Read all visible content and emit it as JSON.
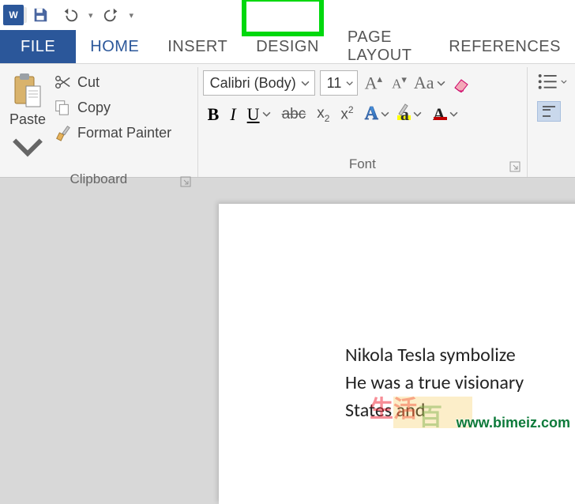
{
  "qat": {
    "save": "save",
    "undo": "undo",
    "redo": "redo"
  },
  "tabs": {
    "file": "FILE",
    "home": "HOME",
    "insert": "INSERT",
    "design": "DESIGN",
    "pagelayout": "PAGE LAYOUT",
    "references": "REFERENCES"
  },
  "clipboard": {
    "paste": "Paste",
    "cut": "Cut",
    "copy": "Copy",
    "formatpainter": "Format Painter",
    "group_label": "Clipboard"
  },
  "font": {
    "name": "Calibri (Body)",
    "size": "11",
    "case_label": "Aa",
    "bold": "B",
    "italic": "I",
    "underline": "U",
    "strike": "abc",
    "subscript": "x",
    "subscript_index": "2",
    "superscript": "x",
    "superscript_index": "2",
    "effects_A": "A",
    "highlight_A": "a",
    "color_A": "A",
    "group_label": "Font"
  },
  "document": {
    "line1": "Nikola Tesla symbolize",
    "line2": "He was a true visionary",
    "line3": "States and"
  },
  "watermark": "www.bimeiz.com"
}
